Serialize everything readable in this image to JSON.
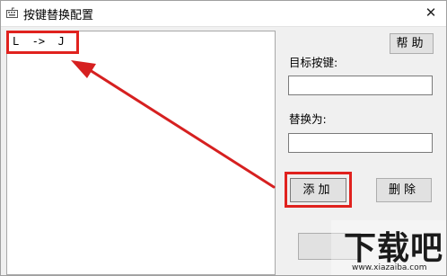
{
  "window": {
    "title": "按键替换配置",
    "close_glyph": "✕"
  },
  "list": {
    "items": [
      "L  ->  J"
    ]
  },
  "buttons": {
    "help": "帮助",
    "add": "添加",
    "delete": "删除"
  },
  "fields": {
    "target_label": "目标按键:",
    "target_value": "",
    "replace_label": "替换为:",
    "replace_value": ""
  },
  "annotations": {
    "highlight_color": "#e0221e",
    "arrow_icon": "red-arrow-icon"
  },
  "watermark": {
    "logo_text": "下载吧",
    "url": "www.xiazaiba.com"
  }
}
